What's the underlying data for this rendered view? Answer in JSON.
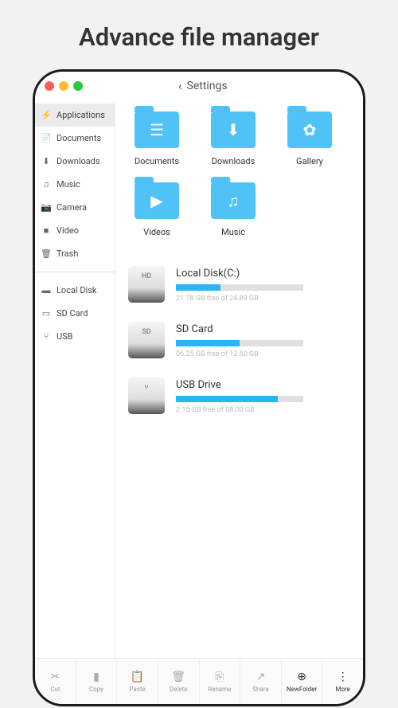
{
  "pageTitle": "Advance file manager",
  "header": {
    "backText": "Settings"
  },
  "sidebar": {
    "groupA": [
      {
        "icon": "⚡",
        "label": "Applications",
        "active": true
      },
      {
        "icon": "📄",
        "label": "Documents"
      },
      {
        "icon": "⬇",
        "label": "Downloads"
      },
      {
        "icon": "♫",
        "label": "Music"
      },
      {
        "icon": "📷",
        "label": "Camera"
      },
      {
        "icon": "■",
        "label": "Video"
      },
      {
        "icon": "🗑",
        "label": "Trash"
      }
    ],
    "groupB": [
      {
        "icon": "▬",
        "label": "Local Disk"
      },
      {
        "icon": "▭",
        "label": "SD Card"
      },
      {
        "icon": "⑂",
        "label": "USB"
      }
    ]
  },
  "folders": [
    {
      "label": "Documents",
      "glyph": "☰"
    },
    {
      "label": "Downloads",
      "glyph": "⬇"
    },
    {
      "label": "Gallery",
      "glyph": "✿"
    },
    {
      "label": "Videos",
      "glyph": "▶"
    },
    {
      "label": "Music",
      "glyph": "♫"
    }
  ],
  "drives": [
    {
      "badge": "HD",
      "name": "Local Disk(C:)",
      "free": "21.78 GB free of 24.89 GB",
      "pct": 35
    },
    {
      "badge": "SD",
      "name": "SD Card",
      "free": "06.25 GB free of 12.50 GB",
      "pct": 50
    },
    {
      "badge": "⑂",
      "name": "USB Drive",
      "free": "2.15 GB free of 08.00 GB",
      "pct": 80
    }
  ],
  "toolbar": [
    {
      "icon": "✂",
      "label": "Cut",
      "dark": false
    },
    {
      "icon": "▮",
      "label": "Copy",
      "dark": false
    },
    {
      "icon": "📋",
      "label": "Paste",
      "dark": false
    },
    {
      "icon": "🗑",
      "label": "Delete",
      "dark": false
    },
    {
      "icon": "⎘",
      "label": "Rename",
      "dark": false
    },
    {
      "icon": "↗",
      "label": "Share",
      "dark": false
    },
    {
      "icon": "⊕",
      "label": "NewFolder",
      "dark": true
    },
    {
      "icon": "⋮",
      "label": "More",
      "dark": true
    }
  ]
}
